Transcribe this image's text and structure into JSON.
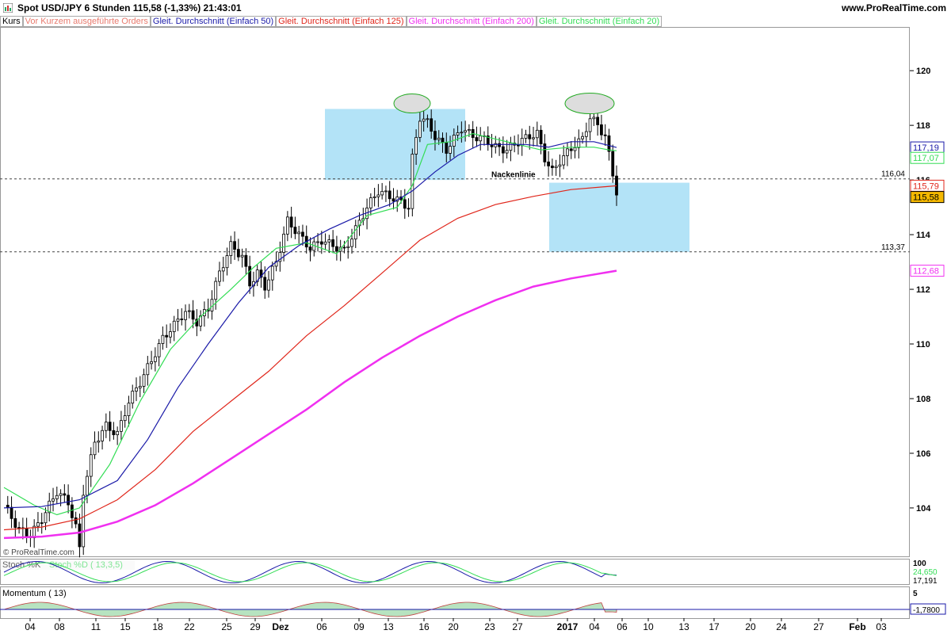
{
  "header": {
    "title": "Spot USD/JPY   6 Stunden   115,58 (-1,33%)   21:43:01",
    "brand": "www.ProRealTime.com",
    "copyright": "© ProRealTime.com"
  },
  "legend": [
    {
      "label": "Kurs",
      "color": "#000000"
    },
    {
      "label": "Vor Kurzem ausgeführte Orders",
      "color": "#e87a6e"
    },
    {
      "label": "Gleit. Durchschnitt (Einfach 50)",
      "color": "#1a1aa8"
    },
    {
      "label": "Gleit. Durchschnitt (Einfach 125)",
      "color": "#e0261b"
    },
    {
      "label": "Gleit. Durchschnitt (Einfach 200)",
      "color": "#f030f0"
    },
    {
      "label": "Gleit. Durchschnitt (Einfach 20)",
      "color": "#33dd55"
    }
  ],
  "chart_data": [
    {
      "type": "candlestick",
      "title": "Spot USD/JPY 6 Stunden",
      "ylim": [
        102.2,
        121.6
      ],
      "y_ticks": [
        "120",
        "118",
        "116",
        "114",
        "112",
        "110",
        "108",
        "106",
        "104"
      ],
      "x_ticks": [
        "04",
        "08",
        "11",
        "15",
        "18",
        "22",
        "25",
        "29",
        "Dez",
        "06",
        "09",
        "13",
        "16",
        "20",
        "23",
        "27",
        "2017",
        "04",
        "06",
        "10",
        "13",
        "17",
        "20",
        "24",
        "27",
        "Feb",
        "03"
      ],
      "grid": true,
      "ohlc_approx": {
        "start": 104.2,
        "end": 115.58,
        "peak_1": 118.6,
        "peak_2": 118.6,
        "low": 102.2
      },
      "close_path": [
        [
          0,
          104.1
        ],
        [
          4,
          103.2
        ],
        [
          7,
          103.0
        ],
        [
          10,
          103.6
        ],
        [
          14,
          104.6
        ],
        [
          17,
          104.2
        ],
        [
          19,
          103.3
        ],
        [
          20,
          102.5
        ],
        [
          21,
          104.6
        ],
        [
          24,
          106.4
        ],
        [
          27,
          107.0
        ],
        [
          30,
          106.7
        ],
        [
          33,
          107.9
        ],
        [
          36,
          108.6
        ],
        [
          39,
          109.4
        ],
        [
          42,
          110.2
        ],
        [
          45,
          110.7
        ],
        [
          48,
          111.2
        ],
        [
          51,
          110.8
        ],
        [
          54,
          111.3
        ],
        [
          57,
          112.6
        ],
        [
          60,
          113.6
        ],
        [
          63,
          113.2
        ],
        [
          65,
          112.2
        ],
        [
          67,
          112.6
        ],
        [
          69,
          112.1
        ],
        [
          72,
          113.0
        ],
        [
          75,
          114.5
        ],
        [
          78,
          114.0
        ],
        [
          81,
          113.5
        ],
        [
          84,
          113.8
        ],
        [
          87,
          113.6
        ],
        [
          90,
          113.4
        ],
        [
          93,
          114.2
        ],
        [
          96,
          115.0
        ],
        [
          99,
          115.6
        ],
        [
          102,
          115.4
        ],
        [
          105,
          115.2
        ],
        [
          107,
          115.0
        ],
        [
          108,
          116.8
        ],
        [
          110,
          118.3
        ],
        [
          112,
          118.1
        ],
        [
          114,
          117.6
        ],
        [
          117,
          117.1
        ],
        [
          119,
          117.5
        ],
        [
          121,
          117.9
        ],
        [
          124,
          117.6
        ],
        [
          127,
          117.5
        ],
        [
          130,
          117.2
        ],
        [
          133,
          117.1
        ],
        [
          136,
          117.4
        ],
        [
          139,
          117.6
        ],
        [
          141,
          117.7
        ],
        [
          143,
          116.8
        ],
        [
          145,
          116.3
        ],
        [
          147,
          116.7
        ],
        [
          149,
          117.0
        ],
        [
          151,
          117.3
        ],
        [
          153,
          117.5
        ],
        [
          155,
          118.3
        ],
        [
          157,
          118.0
        ],
        [
          159,
          117.6
        ],
        [
          160,
          116.9
        ],
        [
          161,
          116.2
        ],
        [
          162,
          115.58
        ]
      ],
      "series": [
        {
          "name": "Gleit. Durchschnitt (Einfach 20)",
          "color": "#33dd55",
          "points": [
            [
              0,
              104.75
            ],
            [
              8,
              104.1
            ],
            [
              14,
              103.75
            ],
            [
              20,
              104.0
            ],
            [
              28,
              105.6
            ],
            [
              36,
              107.9
            ],
            [
              44,
              109.8
            ],
            [
              52,
              111.0
            ],
            [
              60,
              112.0
            ],
            [
              66,
              112.8
            ],
            [
              72,
              113.5
            ],
            [
              80,
              113.7
            ],
            [
              88,
              113.3
            ],
            [
              96,
              114.7
            ],
            [
              104,
              115.0
            ],
            [
              108,
              115.8
            ],
            [
              112,
              117.3
            ],
            [
              118,
              117.4
            ],
            [
              124,
              117.7
            ],
            [
              130,
              117.5
            ],
            [
              136,
              117.3
            ],
            [
              142,
              117.1
            ],
            [
              150,
              117.2
            ],
            [
              156,
              117.2
            ],
            [
              160,
              117.1
            ],
            [
              162,
              117.07
            ]
          ],
          "last_value": "117,07"
        },
        {
          "name": "Gleit. Durchschnitt (Einfach 50)",
          "color": "#1a1aa8",
          "points": [
            [
              0,
              104.0
            ],
            [
              10,
              104.05
            ],
            [
              20,
              104.3
            ],
            [
              30,
              105.0
            ],
            [
              38,
              106.5
            ],
            [
              46,
              108.4
            ],
            [
              54,
              110.0
            ],
            [
              62,
              111.5
            ],
            [
              70,
              112.8
            ],
            [
              78,
              113.6
            ],
            [
              86,
              114.2
            ],
            [
              94,
              114.7
            ],
            [
              102,
              115.1
            ],
            [
              108,
              115.6
            ],
            [
              114,
              116.3
            ],
            [
              120,
              116.9
            ],
            [
              126,
              117.3
            ],
            [
              132,
              117.3
            ],
            [
              138,
              117.3
            ],
            [
              144,
              117.2
            ],
            [
              150,
              117.4
            ],
            [
              156,
              117.4
            ],
            [
              162,
              117.19
            ]
          ],
          "last_value": "117,19"
        },
        {
          "name": "Gleit. Durchschnitt (Einfach 125)",
          "color": "#e0261b",
          "points": [
            [
              0,
              103.2
            ],
            [
              10,
              103.3
            ],
            [
              20,
              103.6
            ],
            [
              30,
              104.3
            ],
            [
              40,
              105.4
            ],
            [
              50,
              106.8
            ],
            [
              60,
              107.9
            ],
            [
              70,
              109.0
            ],
            [
              80,
              110.3
            ],
            [
              90,
              111.4
            ],
            [
              100,
              112.6
            ],
            [
              110,
              113.8
            ],
            [
              120,
              114.6
            ],
            [
              130,
              115.1
            ],
            [
              140,
              115.4
            ],
            [
              150,
              115.65
            ],
            [
              162,
              115.79
            ]
          ],
          "last_value": "115,79"
        },
        {
          "name": "Gleit. Durchschnitt (Einfach 200)",
          "color": "#f030f0",
          "points": [
            [
              0,
              102.9
            ],
            [
              10,
              102.95
            ],
            [
              20,
              103.1
            ],
            [
              30,
              103.5
            ],
            [
              40,
              104.1
            ],
            [
              50,
              104.9
            ],
            [
              60,
              105.8
            ],
            [
              70,
              106.7
            ],
            [
              80,
              107.6
            ],
            [
              90,
              108.6
            ],
            [
              100,
              109.5
            ],
            [
              110,
              110.3
            ],
            [
              120,
              111.0
            ],
            [
              130,
              111.6
            ],
            [
              140,
              112.1
            ],
            [
              150,
              112.4
            ],
            [
              162,
              112.68
            ]
          ],
          "last_value": "112,68"
        }
      ],
      "price_labels": [
        {
          "value": "117,19",
          "color": "#1a1aa8"
        },
        {
          "value": "117,07",
          "color": "#33dd55"
        },
        {
          "value": "115,79",
          "color": "#e0261b"
        },
        {
          "value": "115,58",
          "color": "#000000",
          "bg": "#f5b800"
        },
        {
          "value": "112,68",
          "color": "#f030f0"
        }
      ],
      "levels": [
        {
          "value": 116.04,
          "label": "116,04"
        },
        {
          "value": 113.37,
          "label": "113,37"
        }
      ],
      "annotation": "Nackenlinie"
    },
    {
      "type": "line",
      "title": "Stoch %K",
      "legend": [
        "Stoch %K",
        "Stoch %D ( 13,3,5)"
      ],
      "y_ticks": [
        "100",
        "24,650",
        "17,191"
      ],
      "series": [
        {
          "name": "Stoch %K",
          "color": "#1a1aa8",
          "last_value": "17,191"
        },
        {
          "name": "Stoch %D",
          "color": "#33dd55",
          "last_value": "24,650"
        }
      ]
    },
    {
      "type": "area",
      "title": "Momentum ( 13)",
      "y_ticks": [
        "5",
        "-1,7800"
      ],
      "series": [
        {
          "name": "Momentum",
          "color": "#1a1aa8",
          "last_value": "-1,7800"
        }
      ]
    }
  ],
  "colors": {
    "up": "#ffffff",
    "down": "#000000",
    "highlight_zone": "#b3e3f7",
    "last_price_bg": "#f5b800"
  }
}
